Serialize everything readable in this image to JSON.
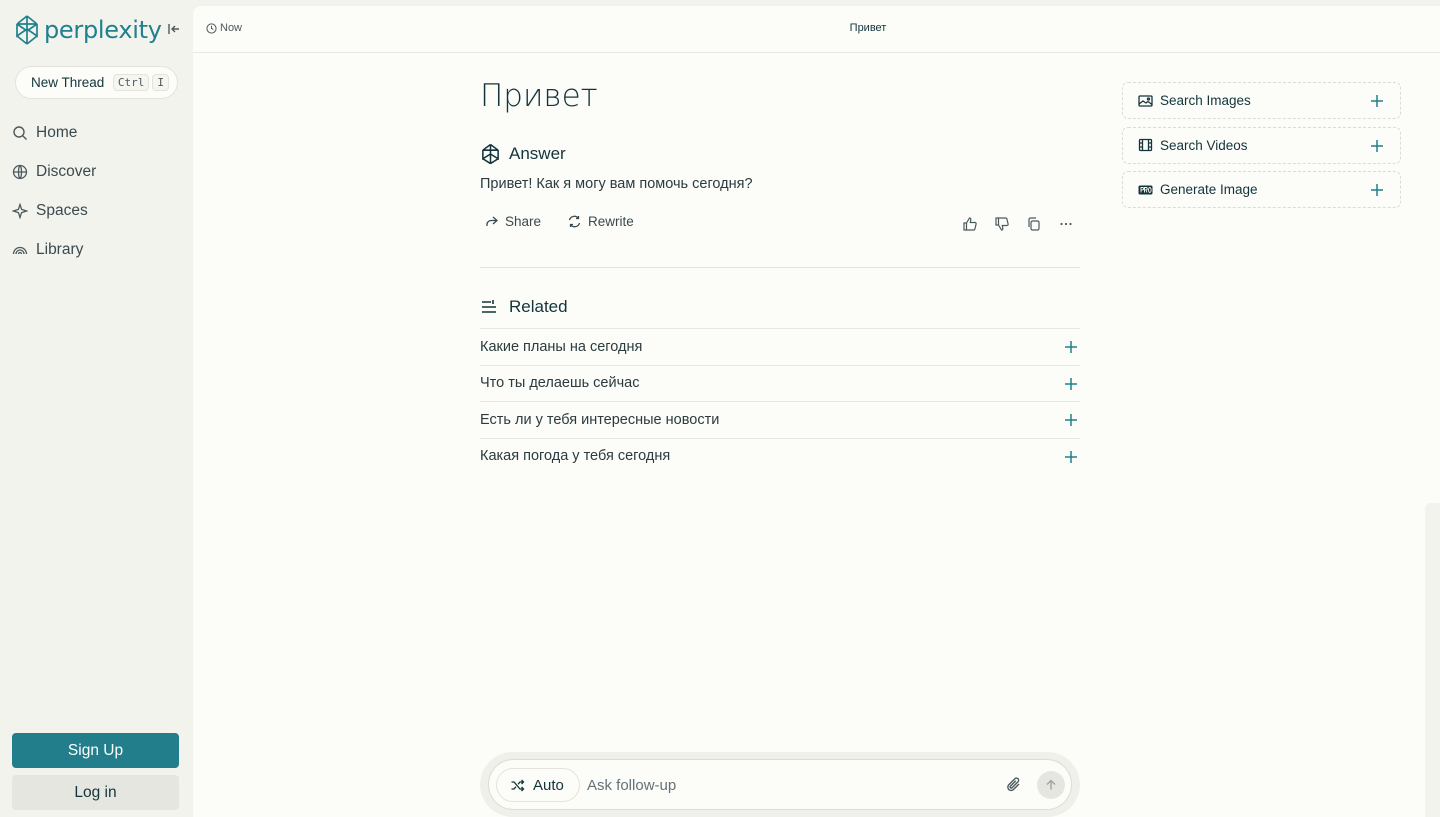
{
  "sidebar": {
    "logo_text": "perplexity",
    "new_thread": {
      "label": "New Thread",
      "kbd": [
        "Ctrl",
        "I"
      ]
    },
    "nav": [
      {
        "label": "Home",
        "icon": "search-icon"
      },
      {
        "label": "Discover",
        "icon": "globe-icon"
      },
      {
        "label": "Spaces",
        "icon": "sparkle-icon"
      },
      {
        "label": "Library",
        "icon": "library-icon"
      }
    ],
    "signup_label": "Sign Up",
    "login_label": "Log in"
  },
  "topbar": {
    "time": "Now",
    "title": "Привет"
  },
  "thread": {
    "query": "Привет",
    "answer_heading": "Answer",
    "answer_text": "Привет! Как я могу вам помочь сегодня?",
    "actions": {
      "share": "Share",
      "rewrite": "Rewrite"
    },
    "related_heading": "Related",
    "related": [
      "Какие планы на сегодня",
      "Что ты делаешь сейчас",
      "Есть ли у тебя интересные новости",
      "Какая погода у тебя сегодня"
    ]
  },
  "side_cards": [
    {
      "label": "Search Images",
      "icon": "image-icon"
    },
    {
      "label": "Search Videos",
      "icon": "film-icon"
    },
    {
      "label": "Generate Image",
      "icon": "pro-badge-icon"
    }
  ],
  "followup": {
    "mode": "Auto",
    "placeholder": "Ask follow-up"
  },
  "colors": {
    "accent": "#20808d",
    "button": "#217e8a",
    "background": "#f3f3ee",
    "panel": "#fcfcf9"
  }
}
